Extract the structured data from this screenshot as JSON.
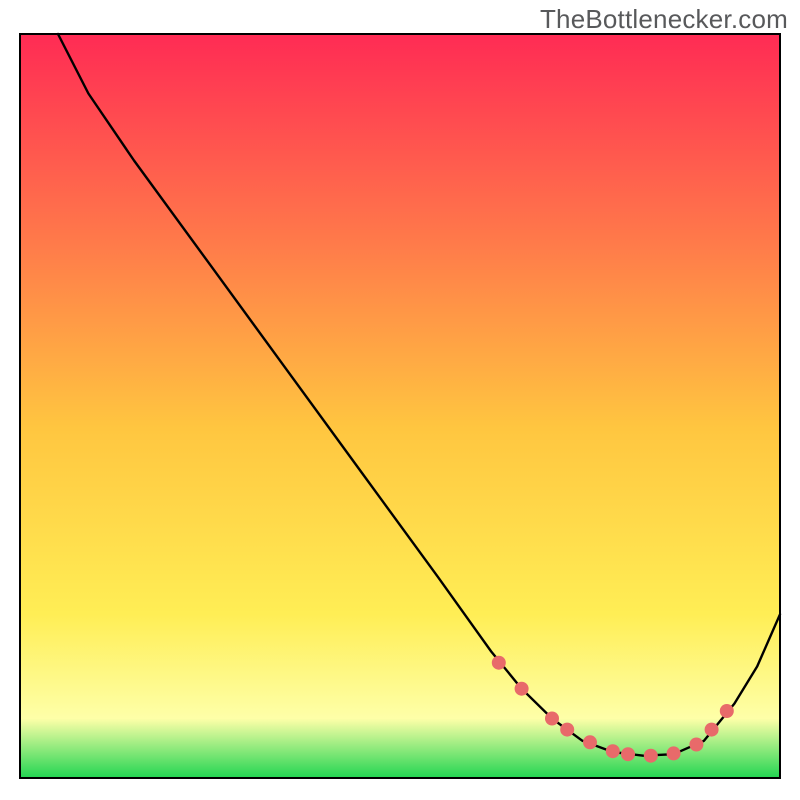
{
  "attribution": "TheBottlenecker.com",
  "colors": {
    "gradient_top": "#ff2b54",
    "gradient_upper": "#ff7a4a",
    "gradient_mid": "#ffc640",
    "gradient_lower": "#ffee55",
    "gradient_pale": "#feffa8",
    "gradient_bottom": "#22d552",
    "curve": "#000000",
    "markers": "#e86a6a",
    "frame": "#000000"
  },
  "chart_data": {
    "type": "line",
    "title": "",
    "xlabel": "",
    "ylabel": "",
    "xlim": [
      0,
      100
    ],
    "ylim": [
      0,
      100
    ],
    "series": [
      {
        "name": "curve",
        "x": [
          5,
          9,
          15,
          25,
          35,
          45,
          55,
          62,
          66,
          70,
          74,
          78,
          82,
          86,
          90,
          94,
          97,
          100
        ],
        "y": [
          100,
          92,
          83,
          69,
          55,
          41,
          27,
          17,
          12,
          8,
          5,
          3.5,
          3,
          3.2,
          5,
          10,
          15,
          22
        ]
      }
    ],
    "markers": [
      {
        "x": 63,
        "y": 15.5
      },
      {
        "x": 66,
        "y": 12
      },
      {
        "x": 70,
        "y": 8
      },
      {
        "x": 72,
        "y": 6.5
      },
      {
        "x": 75,
        "y": 4.8
      },
      {
        "x": 78,
        "y": 3.6
      },
      {
        "x": 80,
        "y": 3.2
      },
      {
        "x": 83,
        "y": 3.0
      },
      {
        "x": 86,
        "y": 3.3
      },
      {
        "x": 89,
        "y": 4.5
      },
      {
        "x": 91,
        "y": 6.5
      },
      {
        "x": 93,
        "y": 9
      }
    ]
  }
}
